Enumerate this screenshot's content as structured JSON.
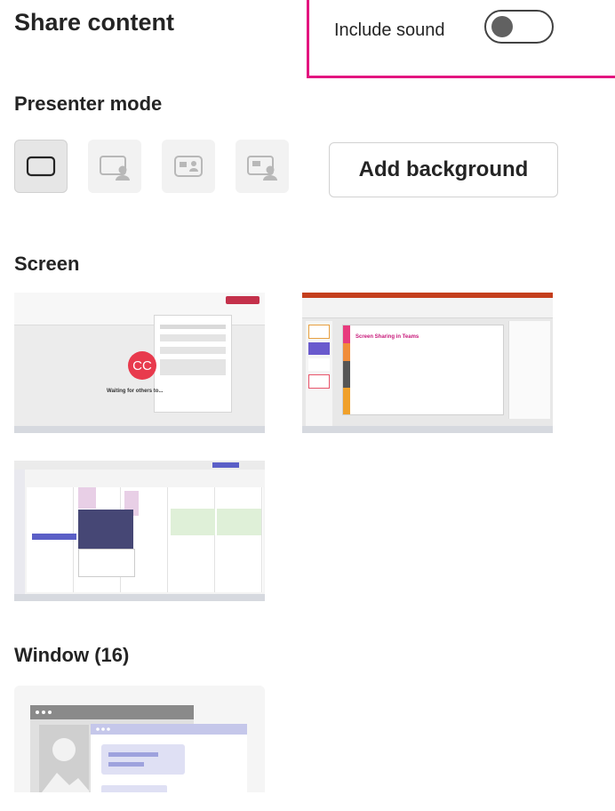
{
  "header": {
    "title": "Share content",
    "include_sound_label": "Include sound",
    "include_sound_on": false
  },
  "presenter_mode": {
    "heading": "Presenter mode",
    "modes": [
      {
        "icon": "content-only-icon",
        "selected": true
      },
      {
        "icon": "standout-icon",
        "selected": false
      },
      {
        "icon": "side-by-side-icon",
        "selected": false
      },
      {
        "icon": "reporter-icon",
        "selected": false
      }
    ],
    "add_background_label": "Add background"
  },
  "screen": {
    "heading": "Screen",
    "thumbnails": [
      {
        "content": "teams-meeting-waiting",
        "avatar_initials": "CC",
        "caption": "Waiting for others to..."
      },
      {
        "content": "powerpoint-slide",
        "slide_title": "Screen Sharing in Teams"
      },
      {
        "content": "teams-calendar"
      }
    ]
  },
  "window": {
    "heading": "Window (16)"
  },
  "colors": {
    "highlight_border": "#e3157f",
    "accent": "#5b5fc7",
    "avatar": "#e83a4d"
  }
}
